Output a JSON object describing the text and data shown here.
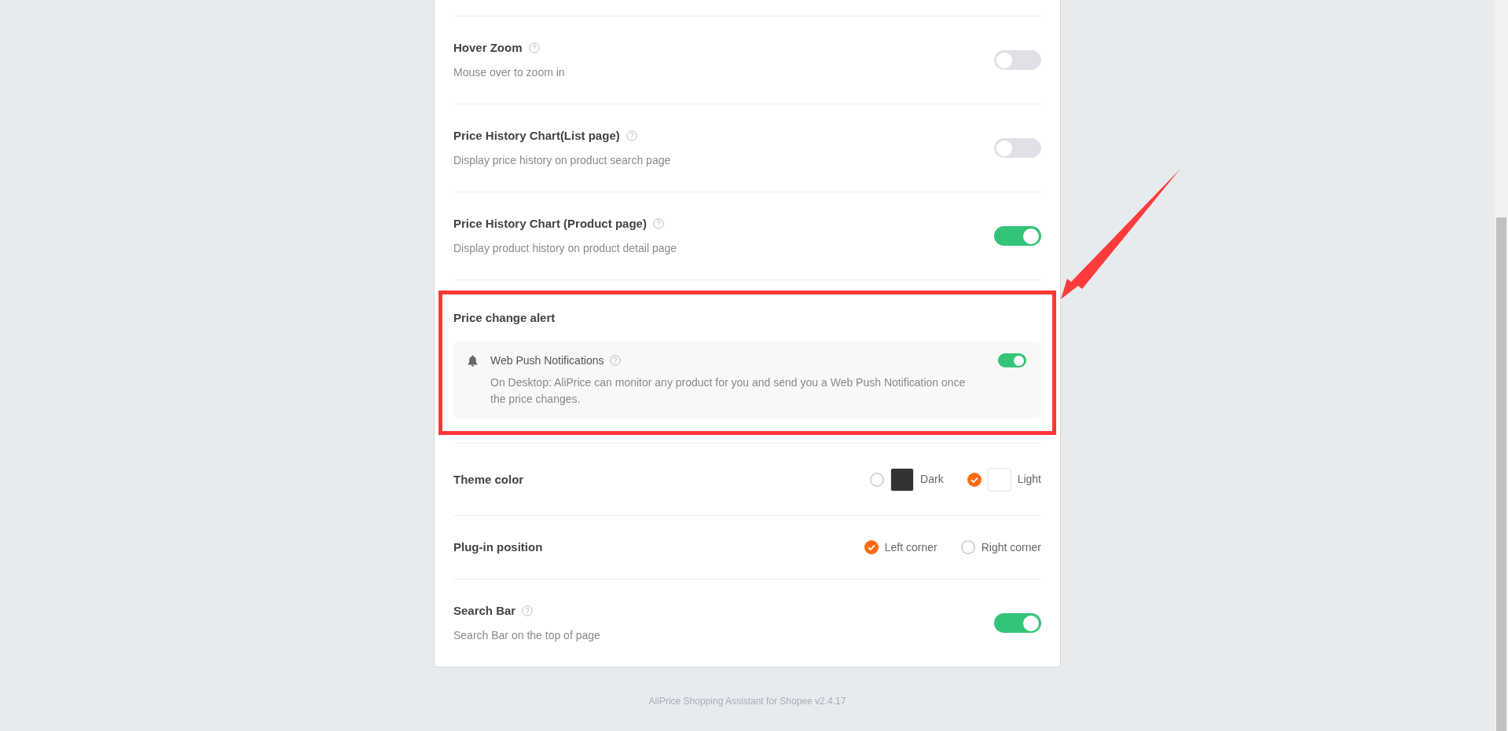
{
  "rows": [
    {
      "kind": "toggle",
      "title": "Hover Zoom",
      "help": true,
      "description": "Mouse over to zoom in",
      "on": false
    },
    {
      "kind": "toggle",
      "title": "Price History Chart(List page)",
      "help": true,
      "description": "Display price history on product search page",
      "on": false
    },
    {
      "kind": "toggle",
      "title": "Price History Chart (Product page)",
      "help": true,
      "description": "Display product history on product detail page",
      "on": true
    },
    {
      "kind": "group",
      "title": "Price change alert",
      "highlighted": true,
      "item": {
        "title": "Web Push Notifications",
        "help": true,
        "description": "On Desktop: AliPrice can monitor any product for you and send you a Web Push Notification once the price changes.",
        "on": true
      }
    },
    {
      "kind": "radio",
      "title": "Theme color",
      "options": [
        {
          "label": "Dark",
          "color": "#333333",
          "selected": false
        },
        {
          "label": "Light",
          "color": "#ffffff",
          "selected": true
        }
      ]
    },
    {
      "kind": "radio",
      "title": "Plug-in position",
      "options": [
        {
          "label": "Left corner",
          "selected": true
        },
        {
          "label": "Right corner",
          "selected": false
        }
      ]
    },
    {
      "kind": "toggle",
      "title": "Search Bar",
      "help": true,
      "description": "Search Bar on the top of page",
      "on": true
    }
  ],
  "footer": "AliPrice Shopping Assistant for Shopee v2.4.17"
}
